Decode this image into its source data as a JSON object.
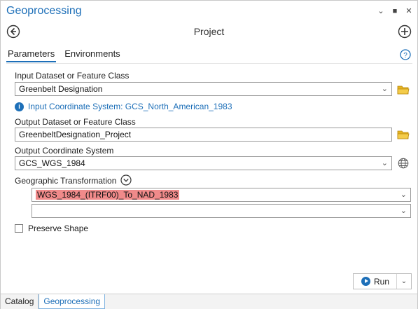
{
  "window": {
    "title": "Geoprocessing"
  },
  "tool": {
    "title": "Project"
  },
  "tabs": [
    {
      "label": "Parameters",
      "active": true
    },
    {
      "label": "Environments",
      "active": false
    }
  ],
  "params": {
    "input_label": "Input Dataset or Feature Class",
    "input_value": "Greenbelt Designation",
    "info_text": "Input Coordinate System: GCS_North_American_1983",
    "output_label": "Output Dataset or Feature Class",
    "output_value": "GreenbeltDesignation_Project",
    "ocs_label": "Output Coordinate System",
    "ocs_value": "GCS_WGS_1984",
    "geo_label": "Geographic Transformation",
    "geo_value_1": "WGS_1984_(ITRF00)_To_NAD_1983",
    "geo_value_2": "",
    "preserve_label": "Preserve Shape",
    "preserve_checked": false
  },
  "actions": {
    "run_label": "Run"
  },
  "bottom_tabs": [
    {
      "label": "Catalog",
      "active": false
    },
    {
      "label": "Geoprocessing",
      "active": true
    }
  ],
  "colors": {
    "accent": "#1d6fb8",
    "highlight": "#f08a8a",
    "folder": "#e6b422"
  },
  "icons": [
    "back-icon",
    "forward-add-icon",
    "help-icon",
    "info-icon",
    "folder-icon",
    "globe-icon",
    "collapse-icon",
    "run-icon"
  ]
}
